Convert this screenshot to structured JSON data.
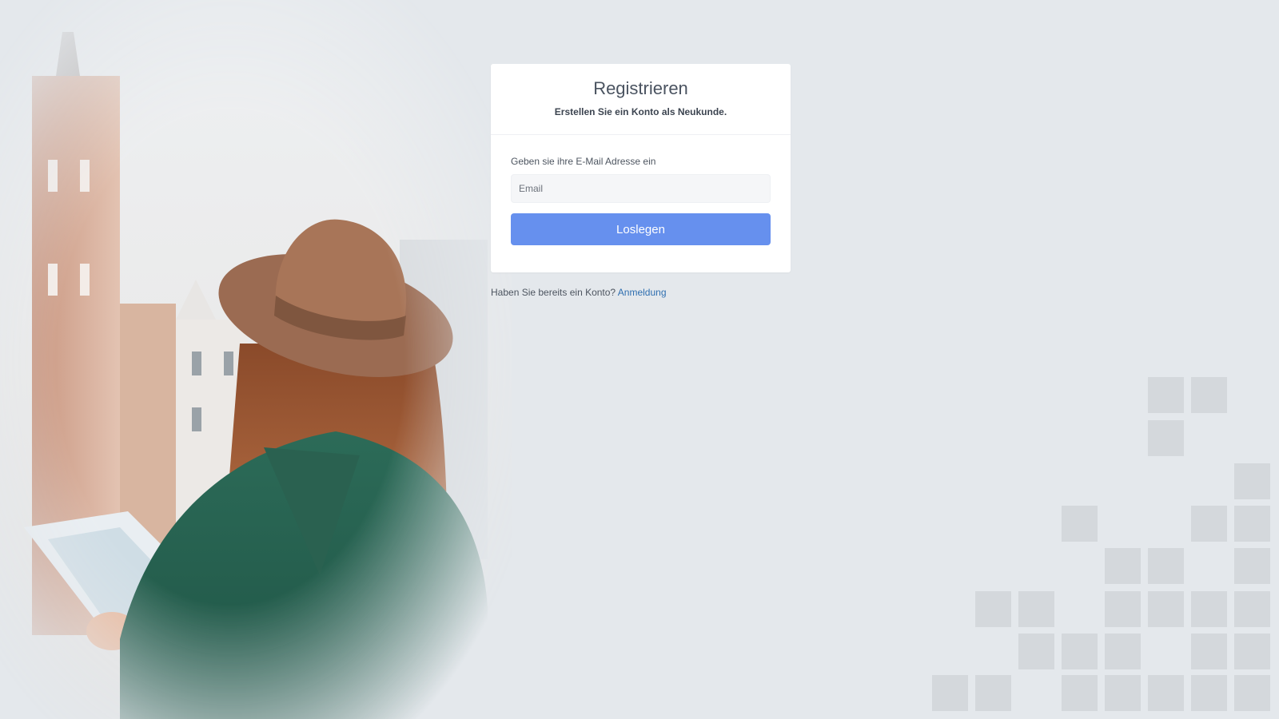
{
  "register": {
    "title": "Registrieren",
    "subtitle": "Erstellen Sie ein Konto als Neukunde.",
    "email_label": "Geben sie ihre E-Mail Adresse ein",
    "email_placeholder": "Email",
    "email_value": "",
    "submit_label": "Loslegen"
  },
  "footer": {
    "question": "Haben Sie bereits ein Konto?",
    "login_link": "Anmeldung"
  },
  "colors": {
    "background": "#e4e8ec",
    "accent_button": "#6690ee",
    "link": "#2f6fb0",
    "decor_squares": "#d4d8dc"
  },
  "icons": {
    "hero_image": "traveler-with-hat-and-map-image"
  }
}
